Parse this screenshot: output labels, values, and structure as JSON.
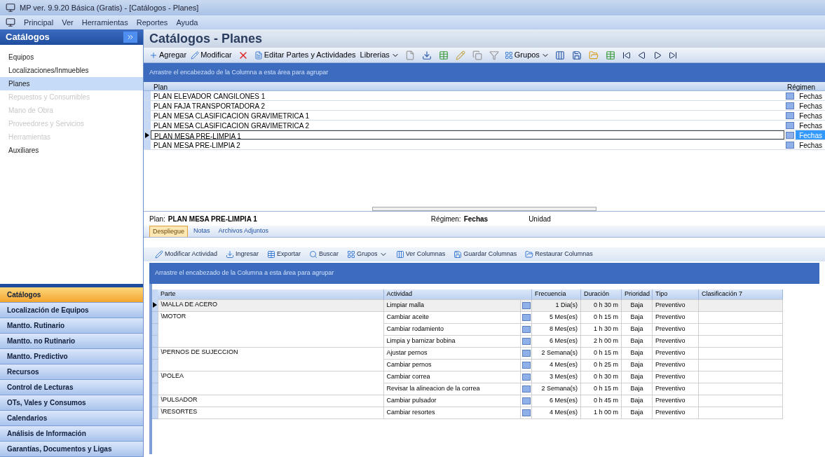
{
  "window": {
    "title": "MP ver. 9.9.20 Básica (Gratis) - [Catálogos - Planes]"
  },
  "menu": [
    "Principal",
    "Ver",
    "Herramientas",
    "Reportes",
    "Ayuda"
  ],
  "sidebar": {
    "header": "Catálogos",
    "items": [
      {
        "label": "Equipos",
        "selected": false,
        "disabled": false
      },
      {
        "label": "Localizaciones/Inmuebles",
        "selected": false,
        "disabled": false
      },
      {
        "label": "Planes",
        "selected": true,
        "disabled": false
      },
      {
        "label": "Repuestos y Consumibles",
        "selected": false,
        "disabled": true
      },
      {
        "label": "Mano de Obra",
        "selected": false,
        "disabled": true
      },
      {
        "label": "Proveedores y Servicios",
        "selected": false,
        "disabled": true
      },
      {
        "label": "Herramientas",
        "selected": false,
        "disabled": true
      },
      {
        "label": "Auxiliares",
        "selected": false,
        "disabled": false
      }
    ],
    "nav": [
      {
        "label": "Catálogos",
        "selected": true
      },
      {
        "label": "Localización de Equipos",
        "selected": false
      },
      {
        "label": "Mantto. Rutinario",
        "selected": false
      },
      {
        "label": "Mantto. no Rutinario",
        "selected": false
      },
      {
        "label": "Mantto. Predictivo",
        "selected": false
      },
      {
        "label": "Recursos",
        "selected": false
      },
      {
        "label": "Control de Lecturas",
        "selected": false
      },
      {
        "label": "OTs, Vales y Consumos",
        "selected": false
      },
      {
        "label": "Calendarios",
        "selected": false
      },
      {
        "label": "Análisis de Información",
        "selected": false
      },
      {
        "label": "Garantías, Documentos y Ligas",
        "selected": false
      }
    ]
  },
  "page_title": "Catálogos - Planes",
  "toolbar": {
    "add": "Agregar",
    "edit": "Modificar",
    "edit_parts": "Editar Partes y Actividades",
    "libraries": "Librerias",
    "groups": "Grupos"
  },
  "plans_grid": {
    "group_hint": "Arrastre el encabezado de la Columna a esta área para agrupar",
    "columns": [
      "Plan",
      "Régimen"
    ],
    "rows": [
      {
        "plan": "PLAN ELEVADOR CANGILONES 1",
        "regimen": "Fechas",
        "selected": false
      },
      {
        "plan": "PLAN FAJA TRANSPORTADORA 2",
        "regimen": "Fechas",
        "selected": false
      },
      {
        "plan": "PLAN MESA CLASIFICACION GRAVIMETRICA 1",
        "regimen": "Fechas",
        "selected": false
      },
      {
        "plan": "PLAN MESA CLASIFICACION GRAVIMETRICA 2",
        "regimen": "Fechas",
        "selected": false
      },
      {
        "plan": "PLAN MESA PRE-LIMPIA 1",
        "regimen": "Fechas",
        "selected": true
      },
      {
        "plan": "PLAN MESA PRE-LIMPIA 2",
        "regimen": "Fechas",
        "selected": false
      }
    ]
  },
  "detail": {
    "plan_label": "Plan:",
    "plan_value": "PLAN MESA PRE-LIMPIA 1",
    "regimen_label": "Régimen:",
    "regimen_value": "Fechas",
    "unit_label": "Unidad",
    "tabs": [
      {
        "label": "Despliegue",
        "selected": true
      },
      {
        "label": "Notas",
        "selected": false
      },
      {
        "label": "Archivos Adjuntos",
        "selected": false
      }
    ],
    "toolbar": [
      "Modificar Actividad",
      "Ingresar",
      "Exportar",
      "Buscar",
      "Grupos",
      "Ver Columnas",
      "Guardar Columnas",
      "Restaurar Columnas"
    ],
    "group_hint": "Arrastre el encabezado de la Columna a esta área para agrupar",
    "columns": [
      "Parte",
      "Actividad",
      "Frecuencia",
      "Duración",
      "Prioridad",
      "Tipo",
      "Clasificación 7"
    ],
    "parts": [
      {
        "name": "\\MALLA DE ACERO",
        "activities": [
          {
            "actividad": "Limpiar malla",
            "frecuencia": "1 Dia(s)",
            "duracion": "0 h 30 m",
            "prioridad": "Baja",
            "tipo": "Preventivo",
            "selected": true
          }
        ]
      },
      {
        "name": "\\MOTOR",
        "activities": [
          {
            "actividad": "Cambiar aceite",
            "frecuencia": "5 Mes(es)",
            "duracion": "0 h 15 m",
            "prioridad": "Baja",
            "tipo": "Preventivo",
            "selected": false
          },
          {
            "actividad": "Cambiar rodamiento",
            "frecuencia": "8 Mes(es)",
            "duracion": "1 h 30 m",
            "prioridad": "Baja",
            "tipo": "Preventivo",
            "selected": false
          },
          {
            "actividad": "Limpia y barnizar bobina",
            "frecuencia": "6 Mes(es)",
            "duracion": "2 h 00 m",
            "prioridad": "Baja",
            "tipo": "Preventivo",
            "selected": false
          }
        ]
      },
      {
        "name": "\\PERNOS DE SUJECCION",
        "activities": [
          {
            "actividad": "Ajustar pernos",
            "frecuencia": "2 Semana(s)",
            "duracion": "0 h 15 m",
            "prioridad": "Baja",
            "tipo": "Preventivo",
            "selected": false
          },
          {
            "actividad": "Cambiar pernos",
            "frecuencia": "4 Mes(es)",
            "duracion": "0 h 25 m",
            "prioridad": "Baja",
            "tipo": "Preventivo",
            "selected": false
          }
        ]
      },
      {
        "name": "\\POLEA",
        "activities": [
          {
            "actividad": "Cambiar correa",
            "frecuencia": "3 Mes(es)",
            "duracion": "0 h 30 m",
            "prioridad": "Baja",
            "tipo": "Preventivo",
            "selected": false
          },
          {
            "actividad": "Revisar la alineacion de la correa",
            "frecuencia": "2 Semana(s)",
            "duracion": "0 h 15 m",
            "prioridad": "Baja",
            "tipo": "Preventivo",
            "selected": false
          }
        ]
      },
      {
        "name": "\\PULSADOR",
        "activities": [
          {
            "actividad": "Cambiar pulsador",
            "frecuencia": "6 Mes(es)",
            "duracion": "0 h 45 m",
            "prioridad": "Baja",
            "tipo": "Preventivo",
            "selected": false
          }
        ]
      },
      {
        "name": "\\RESORTES",
        "activities": [
          {
            "actividad": "Cambiar resortes",
            "frecuencia": "4 Mes(es)",
            "duracion": "1 h 00 m",
            "prioridad": "Baja",
            "tipo": "Preventivo",
            "selected": false
          }
        ]
      }
    ]
  }
}
